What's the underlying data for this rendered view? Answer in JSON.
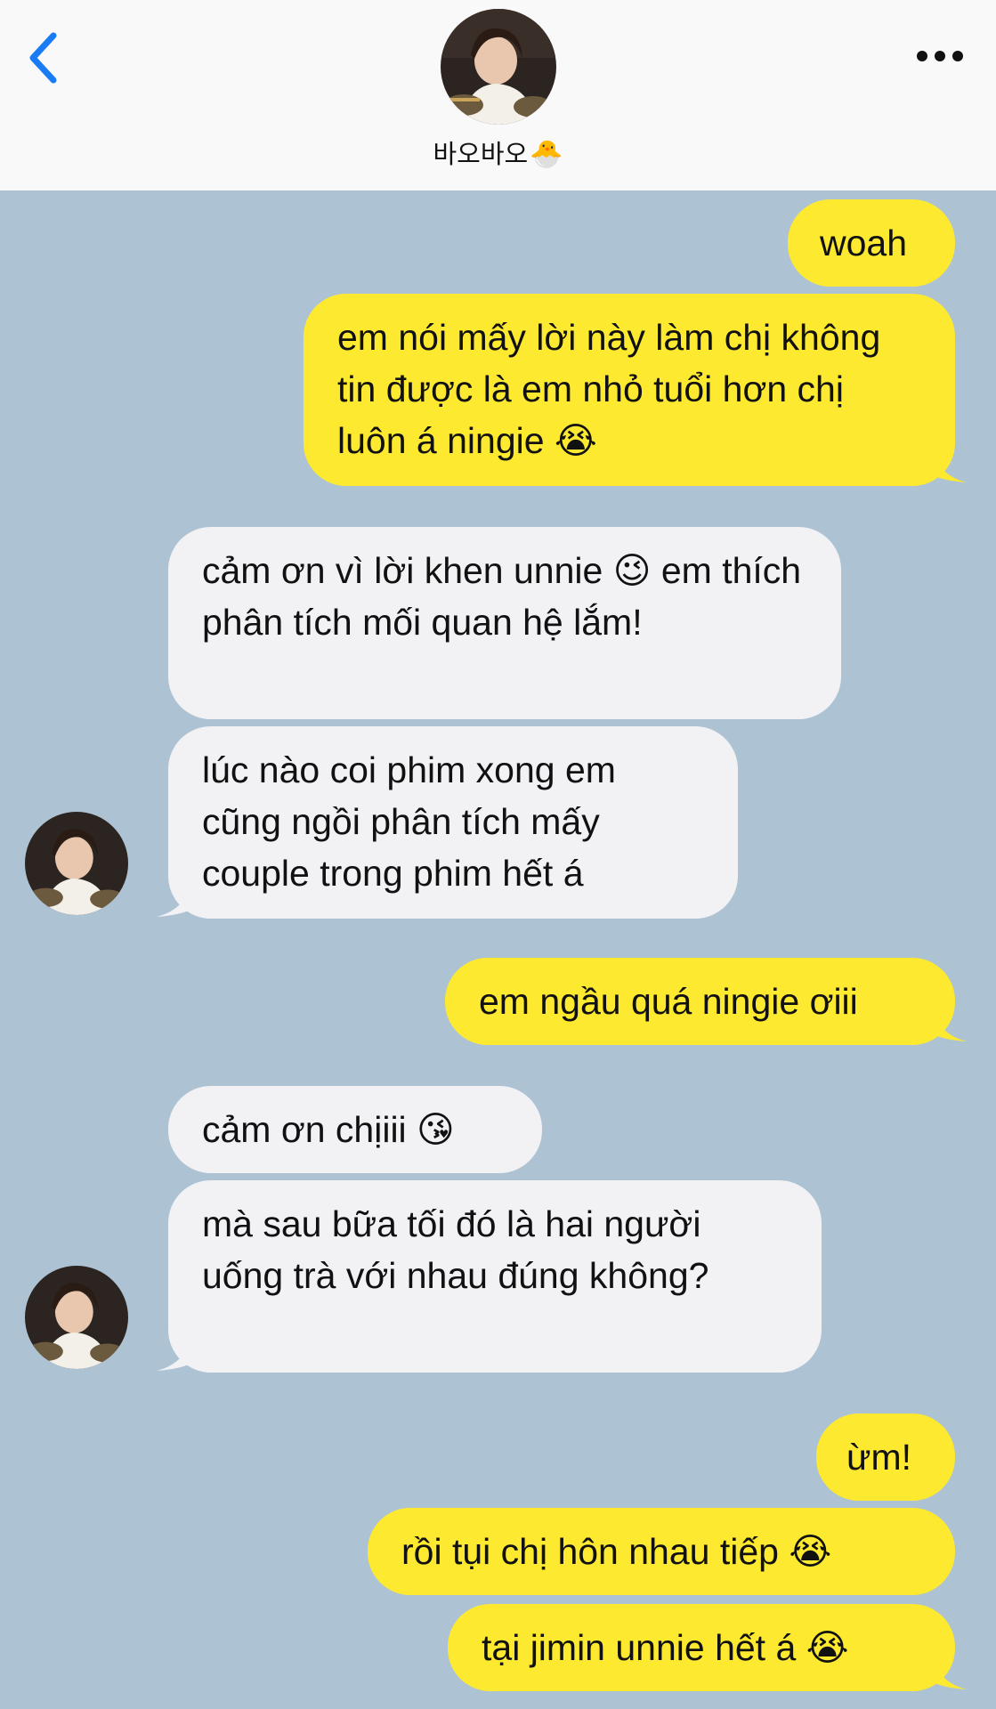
{
  "header": {
    "contact_name": "바오바오",
    "contact_emoji": "🐣"
  },
  "messages": [
    {
      "side": "out",
      "text": "woah"
    },
    {
      "side": "out",
      "text": "em nói mấy lời này làm chị không tin được là em nhỏ tuổi hơn chị luôn á ningie 😭"
    },
    {
      "side": "in",
      "text": "cảm ơn vì lời khen unnie 😉 em thích phân tích mối quan hệ lắm!"
    },
    {
      "side": "in",
      "text": "lúc nào coi phim xong em cũng ngồi phân tích mấy couple trong phim hết á"
    },
    {
      "side": "out",
      "text": "em ngầu quá ningie ơiii"
    },
    {
      "side": "in",
      "text": "cảm ơn chịiii 😘"
    },
    {
      "side": "in",
      "text": "mà sau bữa tối đó là hai người uống trà với nhau đúng không?"
    },
    {
      "side": "out",
      "text": "ừm!"
    },
    {
      "side": "out",
      "text": "rồi tụi chị hôn nhau tiếp 😭"
    },
    {
      "side": "out",
      "text": "tại jimin unnie hết á 😭"
    }
  ],
  "colors": {
    "chat_background": "#adc3d4",
    "outgoing_bubble": "#fde92f",
    "incoming_bubble": "#f2f2f5",
    "accent_blue": "#1a7cf5"
  },
  "icons": {
    "back": "chevron-left-icon",
    "more": "ellipsis-icon"
  }
}
